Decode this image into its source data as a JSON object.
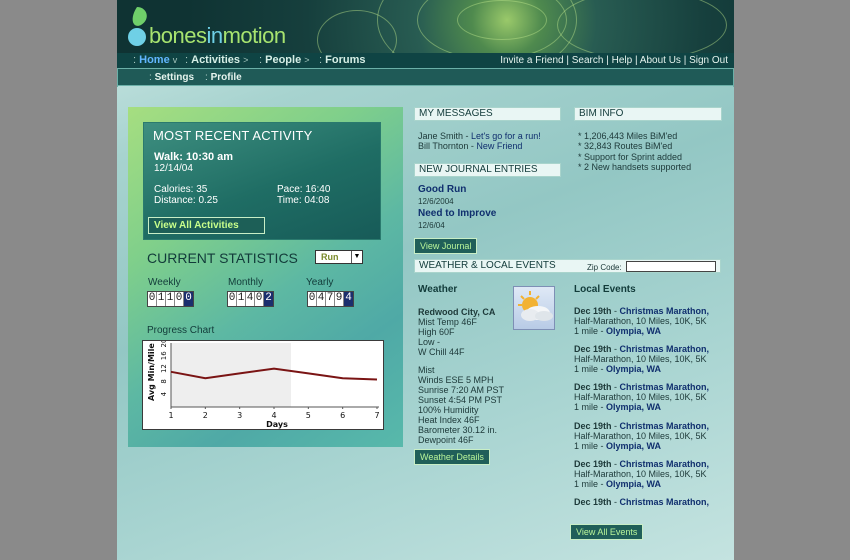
{
  "header": {
    "logo": {
      "text_a": "bones",
      "text_b": "in",
      "text_c": "motion"
    }
  },
  "nav": {
    "home": "Home",
    "activities": "Activities",
    "people": "People",
    "forums": "Forums",
    "links": [
      "Invite a Friend",
      "Search",
      "Help",
      "About Us",
      "Sign Out"
    ]
  },
  "subnav": {
    "settings": "Settings",
    "profile": "Profile"
  },
  "activity": {
    "title": "MOST RECENT ACTIVITY",
    "headline": "Walk: 10:30 am",
    "date": "12/14/04",
    "calories": "Calories: 35",
    "distance": "Distance: 0.25",
    "pace": "Pace: 16:40",
    "time": "Time: 04:08",
    "view_all": "View All Activities"
  },
  "stats": {
    "title": "CURRENT STATISTICS",
    "select_value": "Run",
    "weekly_label": "Weekly",
    "monthly_label": "Monthly",
    "yearly_label": "Yearly",
    "weekly_digits": [
      "0",
      "1",
      "1",
      "0",
      "0"
    ],
    "monthly_digits": [
      "0",
      "1",
      "4",
      "0",
      "2"
    ],
    "yearly_digits": [
      "0",
      "4",
      "7",
      "9",
      "4"
    ]
  },
  "progress": {
    "title": "Progress Chart"
  },
  "chart_data": {
    "type": "line",
    "xlabel": "Days",
    "ylabel": "Avg Min/Mile",
    "x": [
      1,
      2,
      3,
      4,
      5,
      6,
      7
    ],
    "y": [
      11,
      9,
      10.5,
      12,
      10.5,
      9,
      8.6
    ],
    "xlim": [
      1,
      7
    ],
    "ylim": [
      0,
      20
    ],
    "yticks": [
      4,
      8,
      12,
      16,
      20
    ],
    "xticks": [
      1,
      2,
      3,
      4,
      5,
      6,
      7
    ],
    "line_color": "#7a1414"
  },
  "messages": {
    "title": "MY MESSAGES",
    "items": [
      {
        "from": "Jane Smith",
        "subject": "Let's go for a run!"
      },
      {
        "from": "Bill Thornton",
        "subject": "New Friend"
      }
    ]
  },
  "journal": {
    "title": "NEW JOURNAL ENTRIES",
    "entries": [
      {
        "title": "Good Run",
        "date": "12/6/2004"
      },
      {
        "title": "Need to Improve",
        "date": "12/6/04"
      }
    ],
    "view_button": "View Journal"
  },
  "bim": {
    "title": "BIM INFO",
    "items": [
      "* 1,206,443 Miles BiM'ed",
      "* 32,843 Routes BiM'ed",
      "* Support for Sprint added",
      "* 2 New handsets supported"
    ]
  },
  "weather_section": {
    "title": "WEATHER & LOCAL EVENTS",
    "zip_label": "Zip Code:",
    "zip_value": "",
    "weather_heading": "Weather",
    "city": "Redwood City, CA",
    "lines1": [
      "Mist Temp 46F",
      "High 60F",
      "Low -",
      "W Chill 44F"
    ],
    "lines2": [
      "Mist",
      "Winds ESE 5 MPH",
      "Sunrise 7:20 AM PST",
      "Sunset 4:54 PM PST",
      "100% Humidity",
      "Heat Index 46F",
      "Barometer 30.12 in.",
      "Dewpoint 46F"
    ],
    "details_button": "Weather Details",
    "events_heading": "Local Events",
    "events": [
      {
        "date": "Dec 19th",
        "name": "Christmas Marathon,",
        "desc": "Half-Marathon, 10 Miles, 10K, 5K",
        "mile": "1 mile",
        "place": "Olympia, WA"
      },
      {
        "date": "Dec 19th",
        "name": "Christmas Marathon,",
        "desc": "Half-Marathon, 10 Miles, 10K, 5K",
        "mile": "1 mile",
        "place": "Olympia, WA"
      },
      {
        "date": "Dec 19th",
        "name": "Christmas Marathon,",
        "desc": "Half-Marathon, 10 Miles, 10K, 5K",
        "mile": "1 mile",
        "place": "Olympia, WA"
      },
      {
        "date": "Dec 19th",
        "name": "Christmas Marathon,",
        "desc": "Half-Marathon, 10 Miles, 10K, 5K",
        "mile": "1 mile",
        "place": "Olympia, WA"
      },
      {
        "date": "Dec 19th",
        "name": "Christmas Marathon,",
        "desc": "Half-Marathon, 10 Miles, 10K, 5K",
        "mile": "1 mile",
        "place": "Olympia, WA"
      },
      {
        "date": "Dec 19th",
        "name": "Christmas Marathon,",
        "desc": "",
        "mile": "",
        "place": ""
      }
    ],
    "view_all": "View All Events"
  }
}
